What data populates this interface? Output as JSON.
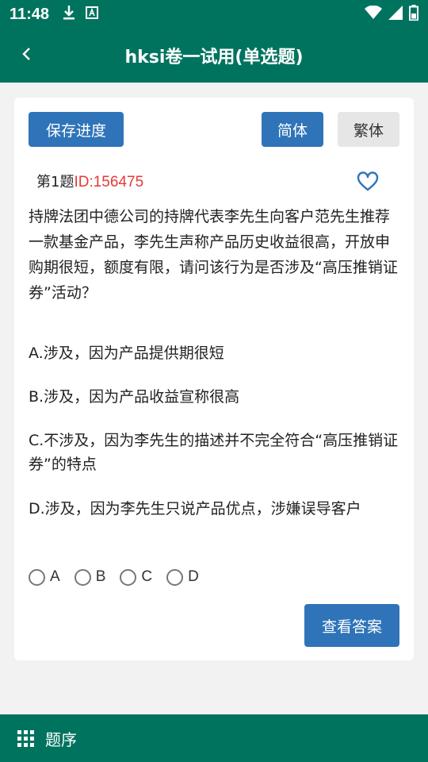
{
  "status_bar": {
    "time": "11:48",
    "left_icons": [
      "download-icon",
      "font-app-icon"
    ],
    "right_icons": [
      "wifi-icon",
      "signal-icon",
      "battery-icon"
    ]
  },
  "app_bar": {
    "back_icon": "chevron-left-icon",
    "title": "hksi卷一试用(单选题)"
  },
  "toolbar": {
    "save_progress": "保存进度",
    "simplified": "简体",
    "traditional": "繁体"
  },
  "question": {
    "number_label": "第1题",
    "id_label": "ID:156475",
    "favorite_icon": "heart-outline-icon",
    "text": "持牌法团中德公司的持牌代表李先生向客户范先生推荐一款基金产品，李先生声称产品历史收益很高，开放申购期很短，额度有限，请问该行为是否涉及“高压推销证券”活动？"
  },
  "options": [
    {
      "text": "A.涉及，因为产品提供期很短"
    },
    {
      "text": "B.涉及，因为产品收益宣称很高"
    },
    {
      "text": "C.不涉及，因为李先生的描述并不完全符合“高压推销证券”的特点"
    },
    {
      "text": "D.涉及，因为李先生只说产品优点，涉嫌误导客户"
    }
  ],
  "answer_choices": [
    "A",
    "B",
    "C",
    "D"
  ],
  "check_answer": "查看答案",
  "bottom_bar": {
    "icon": "grid-icon",
    "label": "题序"
  },
  "colors": {
    "primary": "#00735f",
    "button_blue": "#2f74b8",
    "button_grey": "#e6e6e6",
    "id_red": "#e53935"
  }
}
